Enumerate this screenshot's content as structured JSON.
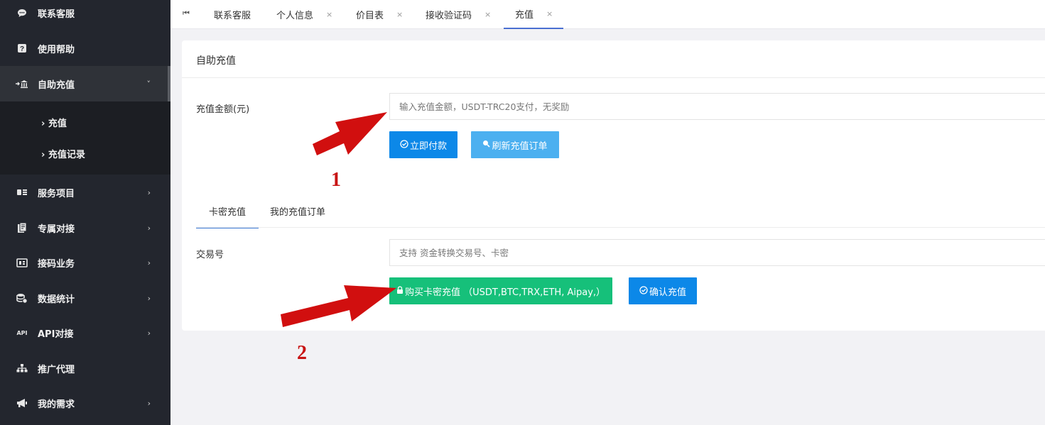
{
  "sidebar": {
    "items": [
      {
        "label": "联系客服",
        "icon": "chat-icon",
        "glyph": "💬"
      },
      {
        "label": "使用帮助",
        "icon": "help-icon",
        "glyph": "?"
      },
      {
        "label": "自助充值",
        "icon": "bank-icon",
        "glyph": "🏦",
        "arrow": "˅"
      },
      {
        "label": "服务项目",
        "icon": "list-icon",
        "glyph": "▤",
        "arrow": "›"
      },
      {
        "label": "专属对接",
        "icon": "docs-icon",
        "glyph": "▧",
        "arrow": "›"
      },
      {
        "label": "接码业务",
        "icon": "sim-icon",
        "glyph": "▦",
        "arrow": "›"
      },
      {
        "label": "数据统计",
        "icon": "database-icon",
        "glyph": "⛁",
        "arrow": "›"
      },
      {
        "label": "API对接",
        "icon": "api-icon",
        "glyph": "API",
        "arrow": "›"
      },
      {
        "label": "推广代理",
        "icon": "sitemap-icon",
        "glyph": "品"
      },
      {
        "label": "我的需求",
        "icon": "bullhorn-icon",
        "glyph": "◀",
        "arrow": "›"
      }
    ],
    "subitems": [
      {
        "label": "› 充值"
      },
      {
        "label": "› 充值记录"
      }
    ]
  },
  "tabs": {
    "home_glyph": "⏮",
    "items": [
      {
        "label": "联系客服",
        "close": ""
      },
      {
        "label": "个人信息",
        "close": "×"
      },
      {
        "label": "价目表",
        "close": "×"
      },
      {
        "label": "接收验证码",
        "close": "×"
      },
      {
        "label": "充值",
        "close": "×"
      }
    ]
  },
  "card": {
    "title": "自助充值",
    "amount_label": "充值金额(元)",
    "amount_placeholder": "输入充值金额，USDT-TRC20支付，无奖励",
    "pay_button": "立即付款",
    "refresh_button": "刷新充值订单",
    "inner_tabs": [
      "卡密充值",
      "我的充值订单"
    ],
    "txid_label": "交易号",
    "txid_placeholder": "支持 资金转换交易号、卡密",
    "buy_card_button": "购买卡密充值 （USDT,BTC,TRX,ETH, Aipay,）",
    "confirm_button": "确认充值"
  },
  "annotations": {
    "num1": "1",
    "num2": "2",
    "arrow_color": "#d10f0f"
  }
}
